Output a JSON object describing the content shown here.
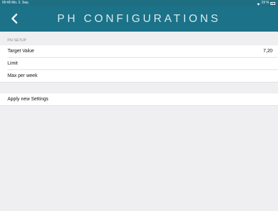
{
  "status_bar": {
    "time_date": "09:49  Mo. 2. Sep.",
    "battery": "19 %",
    "wifi_icon": "wifi-icon",
    "battery_icon": "battery-icon"
  },
  "nav": {
    "title": "PH CONFIGURATIONS",
    "back_icon": "chevron-left-icon",
    "background_color": "#1c7288"
  },
  "section": {
    "header": "PH SETUP",
    "rows": [
      {
        "label": "Target Value",
        "value": "7,20"
      },
      {
        "label": "Limit",
        "value": ""
      },
      {
        "label": "Max per week",
        "value": ""
      }
    ]
  },
  "apply": {
    "label": "Apply new Settings"
  }
}
